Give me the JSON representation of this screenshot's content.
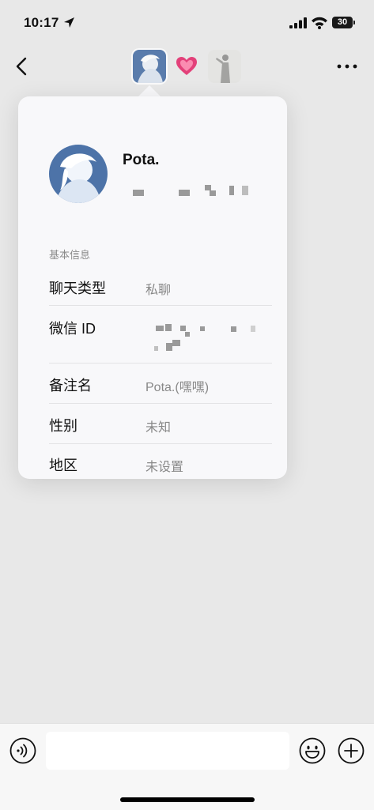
{
  "status_bar": {
    "time": "10:17",
    "battery": "30"
  },
  "nav": {
    "left_avatar_icon": "anime-white-hair-avatar",
    "right_avatar_icon": "silhouette-figure-avatar",
    "heart_icon": "pink-heart-emoji"
  },
  "profile": {
    "name": "Pota.",
    "avatar_icon": "anime-white-hair-avatar"
  },
  "info": {
    "section_label": "基本信息",
    "rows": [
      {
        "label": "聊天类型",
        "value": "私聊"
      },
      {
        "label": "微信 ID",
        "value": ""
      },
      {
        "label": "备注名",
        "value": "Pota.(嘿嘿)"
      },
      {
        "label": "性别",
        "value": "未知"
      },
      {
        "label": "地区",
        "value": "未设置"
      }
    ]
  },
  "input": {
    "value": "",
    "placeholder": ""
  },
  "colors": {
    "background": "#ededed",
    "popover": "#f8f8fa",
    "value_text": "#888888"
  }
}
